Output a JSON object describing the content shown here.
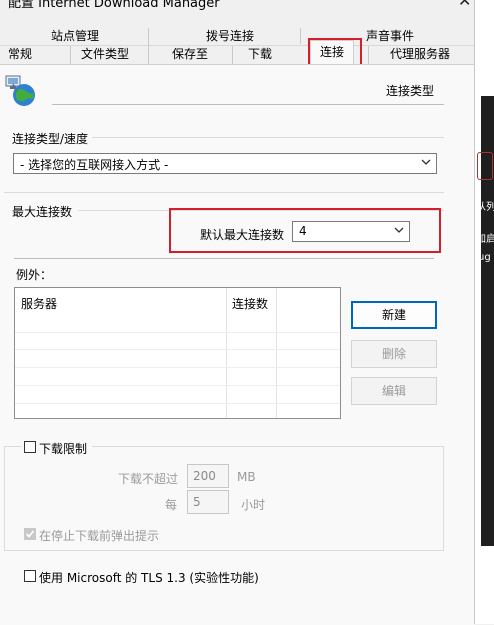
{
  "window": {
    "title": "配置 Internet Download Manager"
  },
  "tabs": {
    "row1": [
      "站点管理",
      "拨号连接",
      "声音事件"
    ],
    "row2": [
      "常规",
      "文件类型",
      "保存至",
      "下载",
      "连接",
      "代理服务器"
    ],
    "active": "连接"
  },
  "header": {
    "section_title": "连接类型",
    "icon": "network-globe-icon"
  },
  "connection": {
    "group_label": "连接类型/速度",
    "select_value": "- 选择您的互联网接入方式 -"
  },
  "max_connections": {
    "group_label": "最大连接数",
    "default_label": "默认最大连接数",
    "default_value": "4",
    "exceptions_label": "例外：",
    "columns": [
      "服务器",
      "连接数"
    ],
    "buttons": {
      "new": "新建",
      "delete": "删除",
      "edit": "编辑"
    }
  },
  "download_limit": {
    "checkbox_label": "下载限制",
    "limit_label": "下载不超过",
    "limit_value": "200",
    "limit_unit": "MB",
    "every_label": "每",
    "every_value": "5",
    "every_unit": "小时",
    "popup_label": "在停止下载前弹出提示"
  },
  "tls": {
    "checkbox_label": "使用 Microsoft 的 TLS 1.3 (实验性功能)"
  },
  "right_strip_texts": [
    "从列",
    "加启",
    "ug"
  ]
}
